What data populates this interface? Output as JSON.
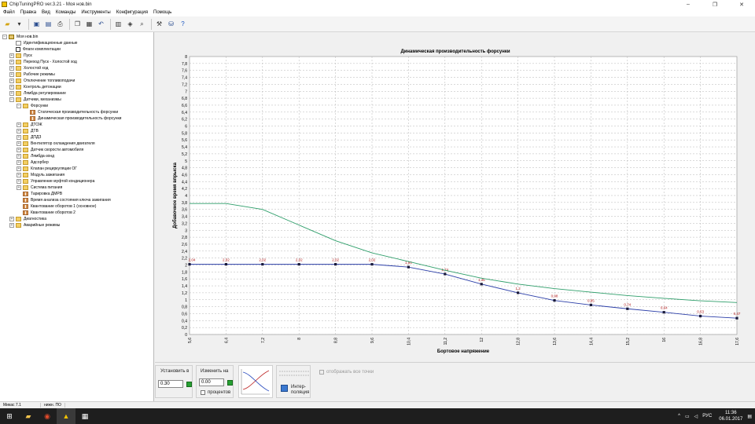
{
  "window": {
    "title": "ChipTuningPRO ver.3.21 - Моя нов.bin",
    "min": "–",
    "max": "❐",
    "close": "✕"
  },
  "menu": [
    "Файл",
    "Правка",
    "Вид",
    "Команды",
    "Инструменты",
    "Конфигурация",
    "Помощь"
  ],
  "tree": {
    "root": "Моя нов.bin",
    "items": [
      {
        "label": "Идентификационные данные",
        "icon": "doc-icon",
        "exp": ""
      },
      {
        "label": "Флаги комплектации",
        "icon": "checkbox-icon",
        "exp": ""
      },
      {
        "label": "Пуск",
        "icon": "folder-icon",
        "exp": "+"
      },
      {
        "label": "Переход Пуск - Холостой ход",
        "icon": "folder-icon",
        "exp": "+"
      },
      {
        "label": "Холостой ход",
        "icon": "folder-icon",
        "exp": "+"
      },
      {
        "label": "Рабочие режимы",
        "icon": "folder-icon",
        "exp": "+"
      },
      {
        "label": "Отключение топливоподачи",
        "icon": "folder-icon",
        "exp": "+"
      },
      {
        "label": "Контроль детонации",
        "icon": "folder-icon",
        "exp": "+"
      },
      {
        "label": "Лямбда регулирование",
        "icon": "folder-icon",
        "exp": "+"
      },
      {
        "label": "Датчики, механизмы",
        "icon": "folder-icon",
        "exp": "−"
      },
      {
        "label": "Форсунки",
        "icon": "folder-icon",
        "exp": "−"
      },
      {
        "label": "Статическая производительность форсунки",
        "icon": "grid-icon",
        "exp": ""
      },
      {
        "label": "Динамическая производительность форсунки",
        "icon": "grid-icon",
        "exp": ""
      },
      {
        "label": "ДТОЖ",
        "icon": "folder-icon",
        "exp": "+"
      },
      {
        "label": "ДТВ",
        "icon": "folder-icon",
        "exp": "+"
      },
      {
        "label": "ДПДЗ",
        "icon": "folder-icon",
        "exp": "+"
      },
      {
        "label": "Вентилятор охлаждения двигателя",
        "icon": "folder-icon",
        "exp": "+"
      },
      {
        "label": "Датчик скорости автомобиля",
        "icon": "folder-icon",
        "exp": "+"
      },
      {
        "label": "Лямбда-зонд",
        "icon": "folder-icon",
        "exp": "+"
      },
      {
        "label": "Адсорбер",
        "icon": "folder-icon",
        "exp": "+"
      },
      {
        "label": "Клапан рециркуляции ОГ",
        "icon": "folder-icon",
        "exp": "+"
      },
      {
        "label": "Модуль зажигания",
        "icon": "folder-icon",
        "exp": "+"
      },
      {
        "label": "Управление муфтой кондиционера",
        "icon": "folder-icon",
        "exp": "+"
      },
      {
        "label": "Система питания",
        "icon": "folder-icon",
        "exp": "+"
      },
      {
        "label": "Тарировка ДМРВ",
        "icon": "grid-icon",
        "exp": ""
      },
      {
        "label": "Время анализа состояния ключа зажигания",
        "icon": "grid-icon",
        "exp": ""
      },
      {
        "label": "Квантование оборотов 1 (основное)",
        "icon": "grid-icon",
        "exp": ""
      },
      {
        "label": "Квантование оборотов 2",
        "icon": "grid-icon",
        "exp": ""
      },
      {
        "label": "Диагностика",
        "icon": "folder-icon",
        "exp": "+"
      },
      {
        "label": "Аварийные режимы",
        "icon": "folder-icon",
        "exp": "+"
      }
    ],
    "levels": [
      1,
      1,
      1,
      1,
      1,
      1,
      1,
      1,
      1,
      1,
      2,
      3,
      3,
      2,
      2,
      2,
      2,
      2,
      2,
      2,
      2,
      2,
      2,
      2,
      2,
      2,
      2,
      2,
      1,
      1
    ]
  },
  "chart_data": {
    "type": "line",
    "title": "Динамическая производительность форсунки",
    "xlabel": "Бортовое напряжение",
    "ylabel": "Добавочное время впрыска",
    "x": [
      5.6,
      6.4,
      7.2,
      8,
      8.8,
      9.6,
      10.4,
      11.2,
      12,
      12.8,
      13.6,
      14.4,
      15.2,
      16,
      16.8,
      17.6
    ],
    "x_tick_labels": [
      "5,6",
      "6,4",
      "7,2",
      "8",
      "8,8",
      "9,6",
      "10,4",
      "11,2",
      "12",
      "12,8",
      "13,6",
      "14,4",
      "15,2",
      "16",
      "16,8",
      "17,6"
    ],
    "ylim": [
      0,
      8
    ],
    "y_tick_labels": [
      "0",
      "0,2",
      "0,4",
      "0,6",
      "0,8",
      "1",
      "1,2",
      "1,4",
      "1,6",
      "1,8",
      "2",
      "2,2",
      "2,4",
      "2,6",
      "2,8",
      "3",
      "3,2",
      "3,4",
      "3,6",
      "3,8",
      "4",
      "4,2",
      "4,4",
      "4,6",
      "4,8",
      "5",
      "5,2",
      "5,4",
      "5,6",
      "5,8",
      "6",
      "6,2",
      "6,4",
      "6,6",
      "6,8",
      "7",
      "7,2",
      "7,4",
      "7,6",
      "7,8",
      "8"
    ],
    "grid": true,
    "series": [
      {
        "values": [
          2.02,
          2.02,
          2.02,
          2.02,
          2.02,
          2.02,
          1.94,
          1.74,
          1.45,
          1.2,
          0.98,
          0.85,
          0.74,
          0.64,
          0.53,
          0.47
        ],
        "point_labels": [
          "2,04",
          "2,02",
          "2,02",
          "2,02",
          "2,02",
          "2,02",
          "1,94",
          "1,74",
          "1,45",
          "1,2",
          "0,98",
          "0,85",
          "0,74",
          "0,64",
          "0,53",
          "0,47"
        ],
        "color": "#2b3ea8"
      },
      {
        "values": [
          3.77,
          3.77,
          3.6,
          3.15,
          2.7,
          2.35,
          2.1,
          1.85,
          1.62,
          1.45,
          1.32,
          1.22,
          1.12,
          1.04,
          0.97,
          0.92
        ],
        "color": "#2e9e6a"
      }
    ]
  },
  "bottom": {
    "set_label": "Установить в",
    "set_value": "0.30",
    "change_label": "Изменить на",
    "change_value": "0.00",
    "percent_label": "процентов",
    "interp_label": "Интер-\nполяция",
    "show_points_label": "отображать все точки"
  },
  "status": [
    "Микас 7.1",
    "нижн. ПО"
  ],
  "taskbar": {
    "lang": "РУС",
    "time": "11:36",
    "date": "06.01.2017"
  }
}
